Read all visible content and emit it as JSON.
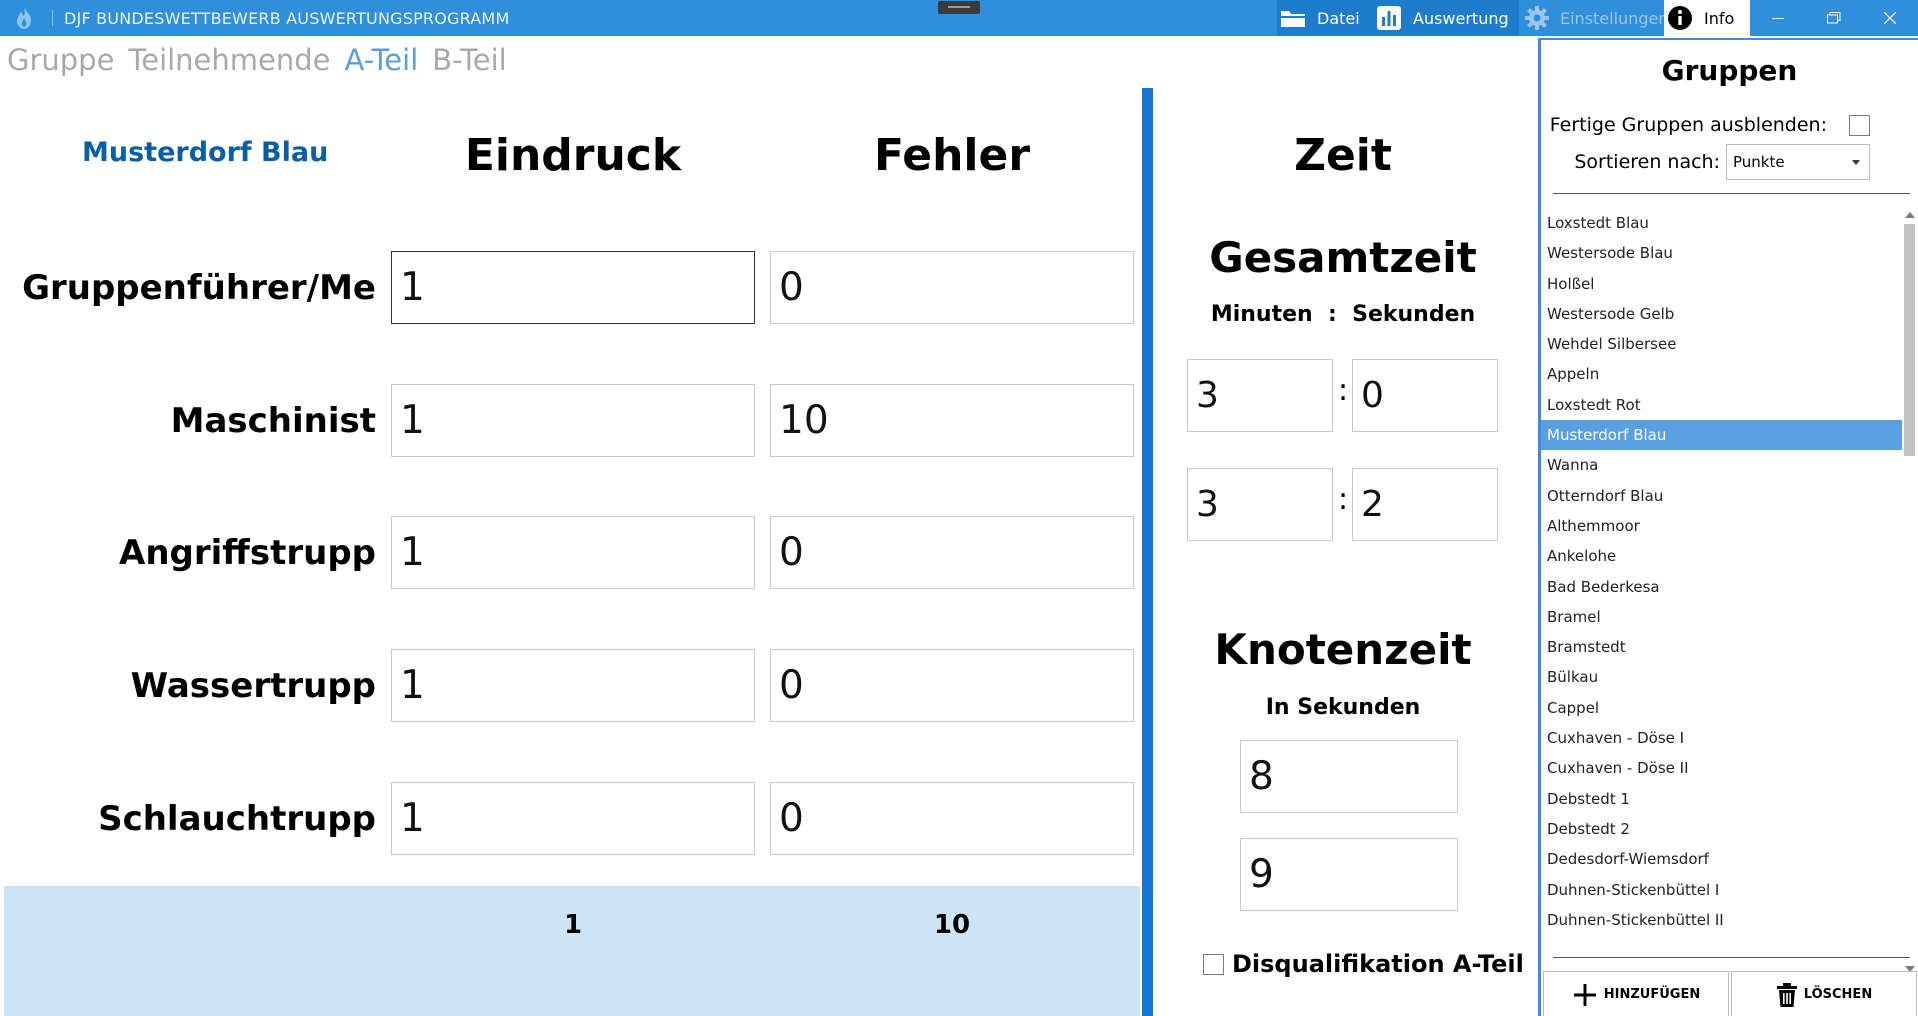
{
  "window": {
    "title": "DJF BUNDESWETTBEWERB AUSWERTUNGSPROGRAMM",
    "menu": {
      "datei_label": "Datei",
      "auswertung_label": "Auswertung",
      "einstellungen_label": "Einstellungen",
      "info_label": "Info"
    },
    "accent_color": "#2f8fdc"
  },
  "nav": {
    "tabs": [
      {
        "label": "Gruppe",
        "active": false
      },
      {
        "label": "Teilnehmende",
        "active": false
      },
      {
        "label": "A-Teil",
        "active": true
      },
      {
        "label": "B-Teil",
        "active": false
      }
    ]
  },
  "evaluation": {
    "group_name": "Musterdorf Blau",
    "eindruck_header": "Eindruck",
    "fehler_header": "Fehler",
    "rows": [
      {
        "label": "Gruppenführer/Me",
        "eindruck": "1",
        "fehler": "0"
      },
      {
        "label": "Maschinist",
        "eindruck": "1",
        "fehler": "10"
      },
      {
        "label": "Angriffstrupp",
        "eindruck": "1",
        "fehler": "0"
      },
      {
        "label": "Wassertrupp",
        "eindruck": "1",
        "fehler": "0"
      },
      {
        "label": "Schlauchtrupp",
        "eindruck": "1",
        "fehler": "0"
      }
    ],
    "sum_eindruck": "1",
    "sum_fehler": "10"
  },
  "zeit": {
    "header": "Zeit",
    "gesamtzeit": {
      "title": "Gesamtzeit",
      "caption": "Minuten  :  Sekunden",
      "entries": [
        {
          "minutes": "3",
          "seconds": "0"
        },
        {
          "minutes": "3",
          "seconds": "2"
        }
      ],
      "separator": ":"
    },
    "knotenzeit": {
      "title": "Knotenzeit",
      "caption": "In Sekunden",
      "entries": [
        "8",
        "9"
      ]
    },
    "disqualifikation_label": "Disqualifikation A-Teil",
    "disqualifikation_checked": false
  },
  "groups_panel": {
    "title": "Gruppen",
    "hide_finished_label": "Fertige Gruppen ausblenden:",
    "hide_finished_checked": false,
    "sort_label": "Sortieren nach:",
    "sort_value": "Punkte",
    "selected": "Musterdorf Blau",
    "items": [
      "Loxstedt Blau",
      "Westersode Blau",
      "Holßel",
      "Westersode Gelb",
      "Wehdel Silbersee",
      "Appeln",
      "Loxstedt Rot",
      "Musterdorf Blau",
      "Wanna",
      "Otterndorf Blau",
      "Althemmoor",
      "Ankelohe",
      "Bad Bederkesa",
      "Bramel",
      "Bramstedt",
      "Bülkau",
      "Cappel",
      "Cuxhaven - Döse I",
      "Cuxhaven - Döse II",
      "Debstedt 1",
      "Debstedt 2",
      "Dedesdorf-Wiemsdorf",
      "Duhnen-Stickenbüttel I",
      "Duhnen-Stickenbüttel II"
    ],
    "add_label": "HINZUFÜGEN",
    "delete_label": "LÖSCHEN"
  }
}
